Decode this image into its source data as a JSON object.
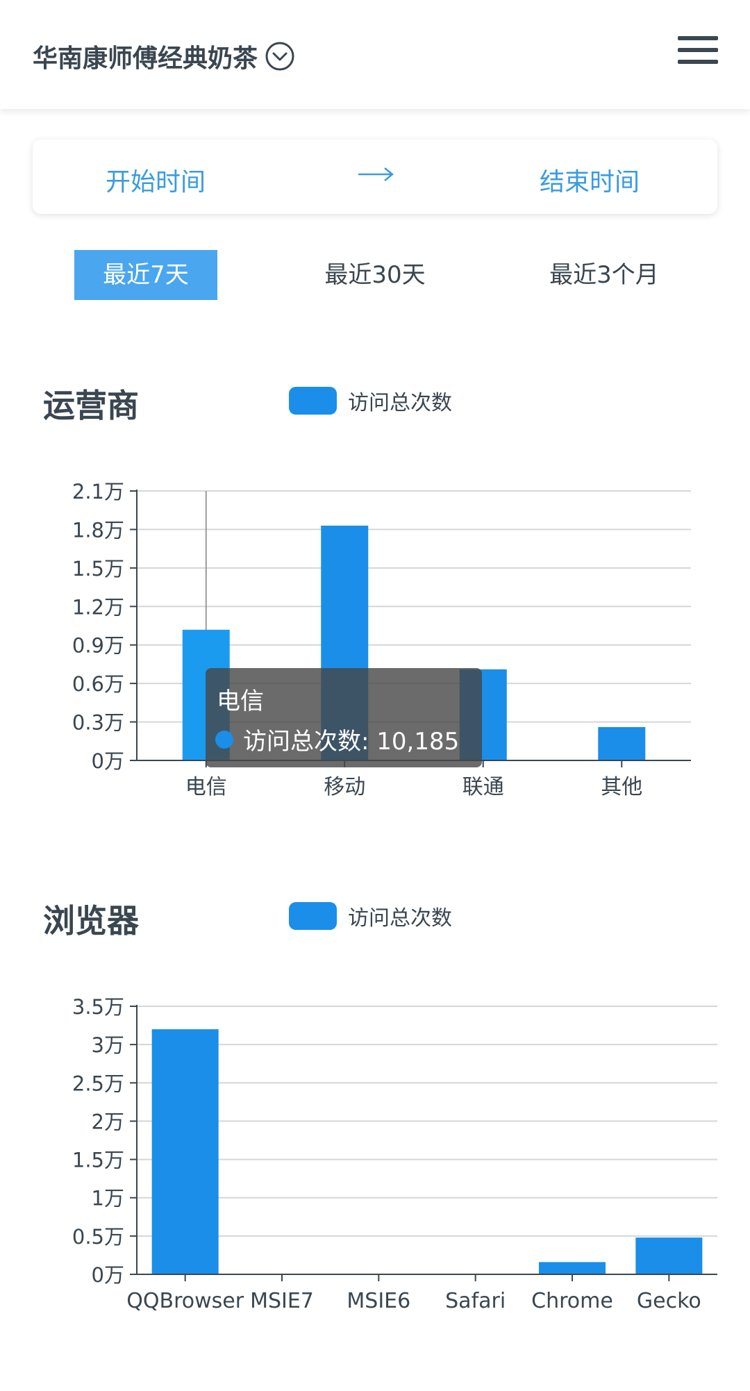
{
  "header": {
    "store_name": "华南康师傅经典奶茶",
    "dropdown_icon": "chevron-down-circle-icon",
    "menu_icon": "hamburger-menu-icon"
  },
  "date_range": {
    "start_label": "开始时间",
    "arrow_icon": "arrow-right-icon",
    "end_label": "结束时间"
  },
  "range_tabs": [
    {
      "label": "最近7天",
      "active": true
    },
    {
      "label": "最近30天",
      "active": false
    },
    {
      "label": "最近3个月",
      "active": false
    }
  ],
  "colors": {
    "accent": "#4aa6ee",
    "bar": "#1a8ee8",
    "bar_highlight": "#1b9bf0",
    "text": "#3a4650",
    "link": "#3a9be0"
  },
  "charts": {
    "carrier": {
      "section_title": "运营商",
      "tooltip": {
        "title": "电信",
        "row": "访问总次数: 10,185"
      }
    },
    "browser": {
      "section_title": "浏览器"
    }
  },
  "chart_data": [
    {
      "type": "bar",
      "title": "运营商",
      "categories": [
        "电信",
        "移动",
        "联通",
        "其他"
      ],
      "series": [
        {
          "name": "访问总次数",
          "values": [
            10185,
            18300,
            7100,
            2600
          ]
        }
      ],
      "ylim": [
        0,
        21000
      ],
      "yticks": [
        "0万",
        "0.3万",
        "0.6万",
        "0.9万",
        "1.2万",
        "1.5万",
        "1.8万",
        "2.1万"
      ],
      "highlight_index": 0,
      "grid": true,
      "legend": "top"
    },
    {
      "type": "bar",
      "title": "浏览器",
      "categories": [
        "QQBrowser",
        "MSIE7",
        "MSIE6",
        "Safari",
        "Chrome",
        "Gecko"
      ],
      "series": [
        {
          "name": "访问总次数",
          "values": [
            32000,
            0,
            0,
            0,
            1600,
            4800
          ]
        }
      ],
      "ylim": [
        0,
        35000
      ],
      "yticks": [
        "0万",
        "0.5万",
        "1万",
        "1.5万",
        "2万",
        "2.5万",
        "3万",
        "3.5万"
      ],
      "grid": true,
      "legend": "top"
    }
  ]
}
